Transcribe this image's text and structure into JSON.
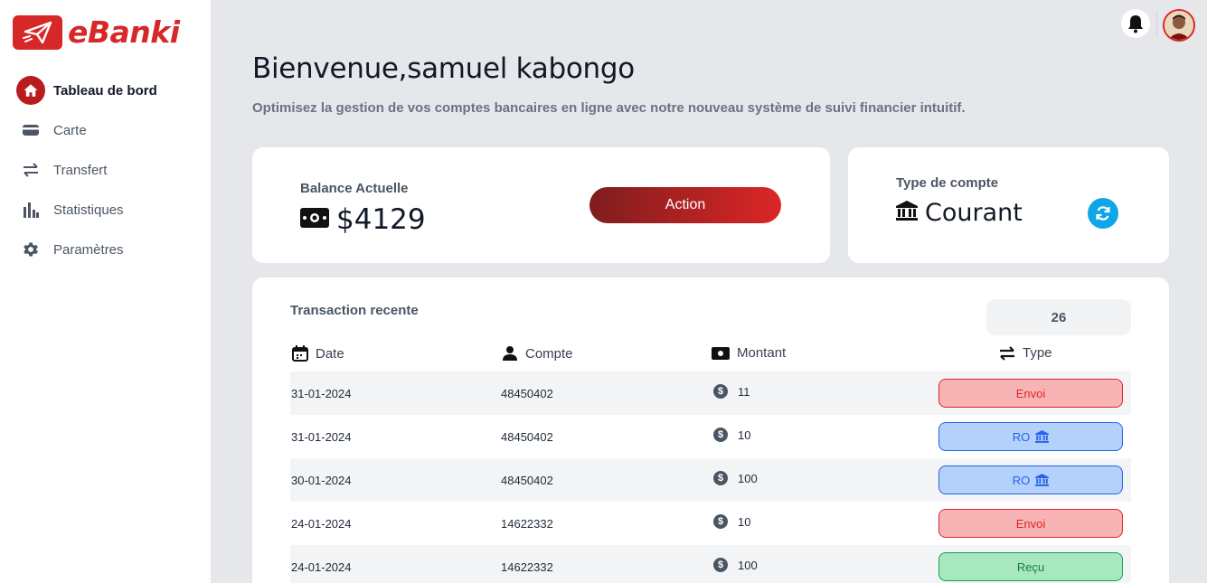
{
  "brand": {
    "name": "eBanki",
    "color": "#d62828"
  },
  "sidebar": {
    "items": [
      {
        "label": "Tableau de bord",
        "icon": "home-icon",
        "active": true
      },
      {
        "label": "Carte",
        "icon": "card-icon",
        "active": false
      },
      {
        "label": "Transfert",
        "icon": "transfer-icon",
        "active": false
      },
      {
        "label": "Statistiques",
        "icon": "bar-chart-icon",
        "active": false
      },
      {
        "label": "Paramètres",
        "icon": "gear-icon",
        "active": false
      }
    ]
  },
  "header": {
    "notification_icon": "bell-icon",
    "avatar_icon": "user-avatar"
  },
  "main": {
    "title": "Bienvenue,samuel kabongo",
    "subtitle": "Optimisez la gestion de vos comptes bancaires en ligne avec notre nouveau système de suivi financier intuitif."
  },
  "balance": {
    "label": "Balance Actuelle",
    "value": "$4129",
    "action_label": "Action",
    "icon": "money-icon"
  },
  "account_type": {
    "label": "Type de compte",
    "value": "Courant",
    "icon": "bank-icon",
    "refresh_icon": "refresh-icon"
  },
  "transactions": {
    "title": "Transaction recente",
    "count": "26",
    "columns": {
      "date": "Date",
      "account": "Compte",
      "amount": "Montant",
      "type": "Type"
    },
    "rows": [
      {
        "date": "31-01-2024",
        "account": "48450402",
        "amount": "11",
        "type": "Envoi",
        "kind": "envoi"
      },
      {
        "date": "31-01-2024",
        "account": "48450402",
        "amount": "10",
        "type": "RO",
        "kind": "ro"
      },
      {
        "date": "30-01-2024",
        "account": "48450402",
        "amount": "100",
        "type": "RO",
        "kind": "ro"
      },
      {
        "date": "24-01-2024",
        "account": "14622332",
        "amount": "10",
        "type": "Envoi",
        "kind": "envoi"
      },
      {
        "date": "24-01-2024",
        "account": "14622332",
        "amount": "100",
        "type": "Reçu",
        "kind": "recu"
      }
    ]
  },
  "colors": {
    "accent": "#d62828",
    "envoi": "#dc2626",
    "ro": "#2563eb",
    "recu": "#16a34a",
    "refresh": "#0ea5e9"
  }
}
